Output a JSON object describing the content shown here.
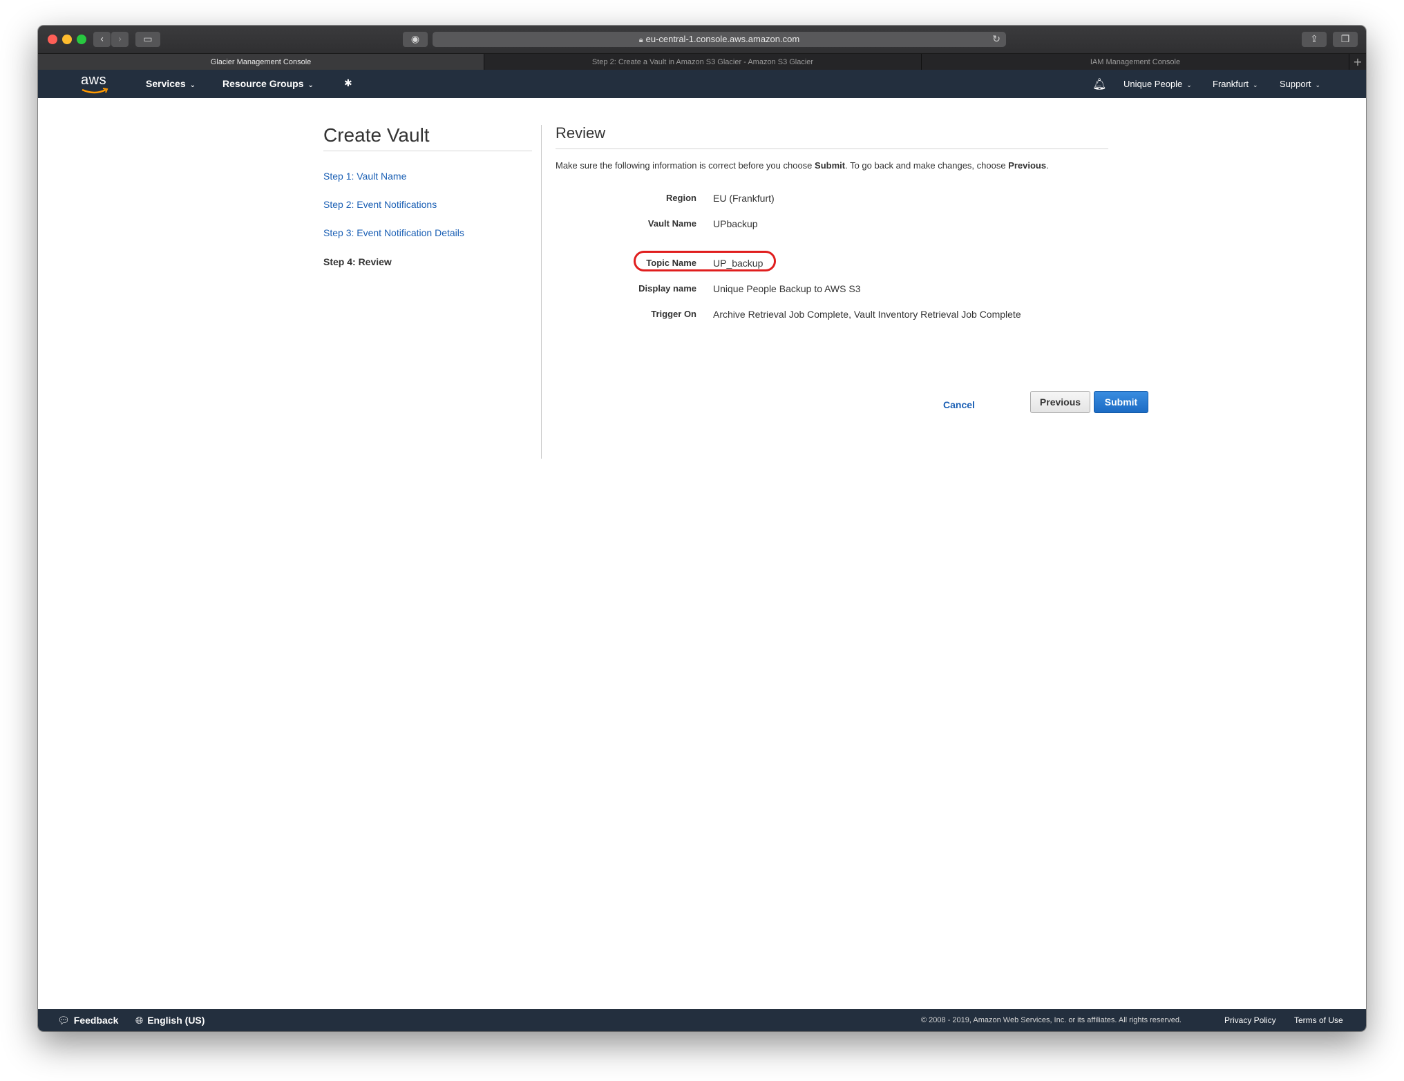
{
  "browser": {
    "url": "eu-central-1.console.aws.amazon.com",
    "tabs": [
      {
        "label": "Glacier Management Console",
        "active": true
      },
      {
        "label": "Step 2: Create a Vault in Amazon S3 Glacier - Amazon S3 Glacier",
        "active": false
      },
      {
        "label": "IAM Management Console",
        "active": false
      }
    ]
  },
  "aws_nav": {
    "logo": "aws",
    "services": "Services",
    "resource_groups": "Resource Groups",
    "account": "Unique People",
    "region": "Frankfurt",
    "support": "Support"
  },
  "wizard": {
    "title": "Create Vault",
    "steps": [
      {
        "label": "Step 1: Vault Name",
        "current": false
      },
      {
        "label": "Step 2: Event Notifications",
        "current": false
      },
      {
        "label": "Step 3: Event Notification Details",
        "current": false
      },
      {
        "label": "Step 4: Review",
        "current": true
      }
    ]
  },
  "review": {
    "title": "Review",
    "intro_prefix": "Make sure the following information is correct before you choose ",
    "intro_submit": "Submit",
    "intro_middle": ". To go back and make changes, choose ",
    "intro_previous": "Previous",
    "intro_suffix": ".",
    "fields": [
      {
        "label": "Region",
        "value": "EU (Frankfurt)"
      },
      {
        "label": "Vault Name",
        "value": "UPbackup"
      },
      {
        "label": "Topic Name",
        "value": "UP_backup"
      },
      {
        "label": "Display name",
        "value": "Unique People Backup to AWS S3"
      },
      {
        "label": "Trigger On",
        "value": "Archive Retrieval Job Complete, Vault Inventory Retrieval Job Complete"
      }
    ],
    "cancel": "Cancel",
    "previous": "Previous",
    "submit": "Submit"
  },
  "footer": {
    "feedback": "Feedback",
    "language": "English (US)",
    "copyright": "© 2008 - 2019, Amazon Web Services, Inc. or its affiliates. All rights reserved.",
    "privacy": "Privacy Policy",
    "terms": "Terms of Use"
  },
  "colors": {
    "nav_bg": "#232f3e",
    "link": "#1a5fb4",
    "submit": "#1c6bc4",
    "highlight": "#e01e1e"
  }
}
